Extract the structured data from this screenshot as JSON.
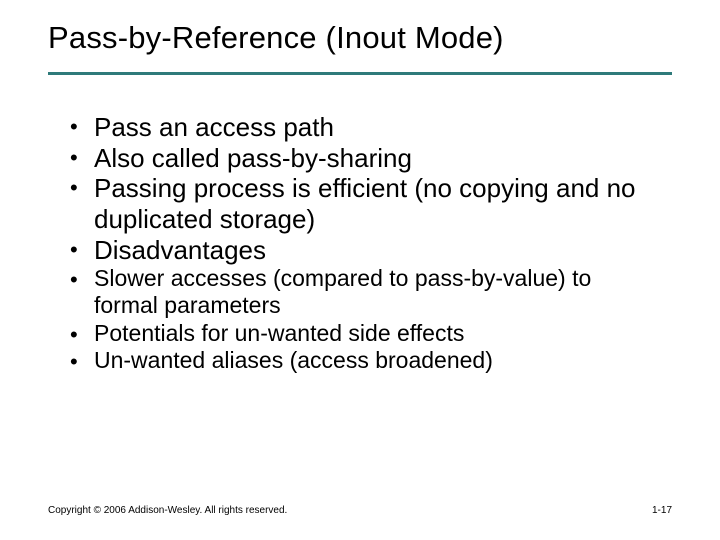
{
  "title": "Pass-by-Reference (Inout Mode)",
  "bullets": {
    "b1": "Pass an access path",
    "b2": "Also called pass-by-sharing",
    "b3": "Passing process is efficient (no copying and no duplicated storage)",
    "b4": "Disadvantages"
  },
  "sub": {
    "s1": "Slower accesses (compared to pass-by-value) to formal parameters",
    "s2": "Potentials for un-wanted side effects",
    "s3": "Un-wanted aliases (access broadened)"
  },
  "footer": {
    "copyright": "Copyright © 2006 Addison-Wesley. All rights reserved.",
    "page": "1-17"
  }
}
